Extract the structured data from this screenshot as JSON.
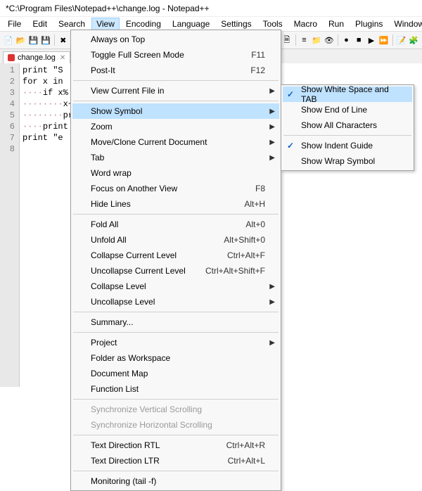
{
  "title": "*C:\\Program Files\\Notepad++\\change.log - Notepad++",
  "menubar": [
    "File",
    "Edit",
    "Search",
    "View",
    "Encoding",
    "Language",
    "Settings",
    "Tools",
    "Macro",
    "Run",
    "Plugins",
    "Window",
    "?"
  ],
  "menubar_active_index": 3,
  "tab": {
    "label": "change.log",
    "dirty": true
  },
  "gutter_lines": [
    "1",
    "2",
    "3",
    "4",
    "5",
    "6",
    "7",
    "8"
  ],
  "code_lines": [
    "print \"S",
    "for x in",
    "····if x%",
    "········x+=",
    "········pri",
    "····print",
    "print \"e",
    ""
  ],
  "view_menu": [
    {
      "type": "item",
      "label": "Always on Top"
    },
    {
      "type": "item",
      "label": "Toggle Full Screen Mode",
      "accel": "F11"
    },
    {
      "type": "item",
      "label": "Post-It",
      "accel": "F12"
    },
    {
      "type": "sep"
    },
    {
      "type": "sub",
      "label": "View Current File in"
    },
    {
      "type": "sep"
    },
    {
      "type": "sub",
      "label": "Show Symbol",
      "hl": true
    },
    {
      "type": "sub",
      "label": "Zoom"
    },
    {
      "type": "sub",
      "label": "Move/Clone Current Document"
    },
    {
      "type": "sub",
      "label": "Tab"
    },
    {
      "type": "item",
      "label": "Word wrap"
    },
    {
      "type": "item",
      "label": "Focus on Another View",
      "accel": "F8"
    },
    {
      "type": "item",
      "label": "Hide Lines",
      "accel": "Alt+H"
    },
    {
      "type": "sep"
    },
    {
      "type": "item",
      "label": "Fold All",
      "accel": "Alt+0"
    },
    {
      "type": "item",
      "label": "Unfold All",
      "accel": "Alt+Shift+0"
    },
    {
      "type": "item",
      "label": "Collapse Current Level",
      "accel": "Ctrl+Alt+F"
    },
    {
      "type": "item",
      "label": "Uncollapse Current Level",
      "accel": "Ctrl+Alt+Shift+F"
    },
    {
      "type": "sub",
      "label": "Collapse Level"
    },
    {
      "type": "sub",
      "label": "Uncollapse Level"
    },
    {
      "type": "sep"
    },
    {
      "type": "item",
      "label": "Summary..."
    },
    {
      "type": "sep"
    },
    {
      "type": "sub",
      "label": "Project"
    },
    {
      "type": "item",
      "label": "Folder as Workspace"
    },
    {
      "type": "item",
      "label": "Document Map"
    },
    {
      "type": "item",
      "label": "Function List"
    },
    {
      "type": "sep"
    },
    {
      "type": "item",
      "label": "Synchronize Vertical Scrolling",
      "disabled": true
    },
    {
      "type": "item",
      "label": "Synchronize Horizontal Scrolling",
      "disabled": true
    },
    {
      "type": "sep"
    },
    {
      "type": "item",
      "label": "Text Direction RTL",
      "accel": "Ctrl+Alt+R"
    },
    {
      "type": "item",
      "label": "Text Direction LTR",
      "accel": "Ctrl+Alt+L"
    },
    {
      "type": "sep"
    },
    {
      "type": "item",
      "label": "Monitoring (tail -f)"
    }
  ],
  "symbol_menu": [
    {
      "label": "Show White Space and TAB",
      "checked": true,
      "hl": true
    },
    {
      "label": "Show End of Line"
    },
    {
      "label": "Show All Characters"
    },
    {
      "type": "sep"
    },
    {
      "label": "Show Indent Guide",
      "checked": true
    },
    {
      "label": "Show Wrap Symbol"
    }
  ],
  "toolbar_icons": [
    "new",
    "open",
    "save",
    "saveall",
    "|",
    "close",
    "closeall",
    "|",
    "cut",
    "copy",
    "paste",
    "|",
    "undo",
    "redo",
    "|",
    "find",
    "replace",
    "|",
    "zoomin",
    "zoomout",
    "|",
    "sync",
    "wrap",
    "allchars",
    "indent",
    "lang",
    "docmap",
    "|",
    "funclist",
    "folder",
    "eye",
    "|",
    "rec",
    "stop",
    "play",
    "playall",
    "|",
    "note",
    "plugin"
  ]
}
